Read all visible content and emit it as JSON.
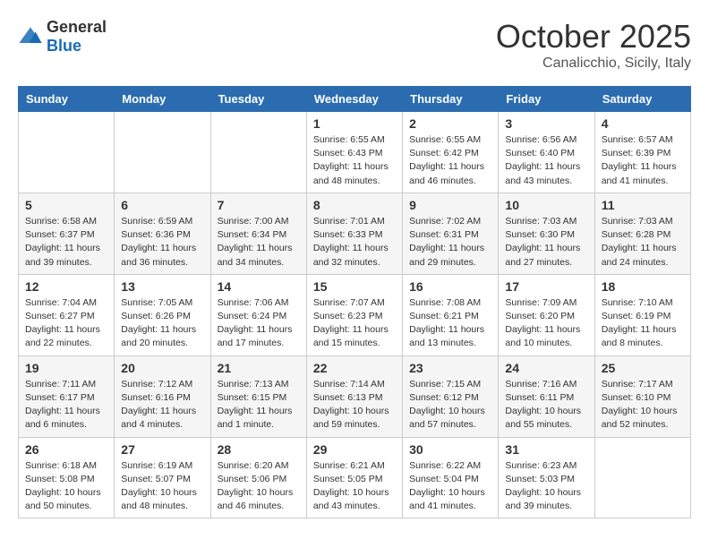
{
  "header": {
    "logo": {
      "general": "General",
      "blue": "Blue"
    },
    "title": "October 2025",
    "location": "Canalicchio, Sicily, Italy"
  },
  "calendar": {
    "weekdays": [
      "Sunday",
      "Monday",
      "Tuesday",
      "Wednesday",
      "Thursday",
      "Friday",
      "Saturday"
    ],
    "weeks": [
      [
        null,
        null,
        null,
        {
          "day": 1,
          "sunrise": "6:55 AM",
          "sunset": "6:43 PM",
          "daylight": "11 hours and 48 minutes."
        },
        {
          "day": 2,
          "sunrise": "6:55 AM",
          "sunset": "6:42 PM",
          "daylight": "11 hours and 46 minutes."
        },
        {
          "day": 3,
          "sunrise": "6:56 AM",
          "sunset": "6:40 PM",
          "daylight": "11 hours and 43 minutes."
        },
        {
          "day": 4,
          "sunrise": "6:57 AM",
          "sunset": "6:39 PM",
          "daylight": "11 hours and 41 minutes."
        }
      ],
      [
        {
          "day": 5,
          "sunrise": "6:58 AM",
          "sunset": "6:37 PM",
          "daylight": "11 hours and 39 minutes."
        },
        {
          "day": 6,
          "sunrise": "6:59 AM",
          "sunset": "6:36 PM",
          "daylight": "11 hours and 36 minutes."
        },
        {
          "day": 7,
          "sunrise": "7:00 AM",
          "sunset": "6:34 PM",
          "daylight": "11 hours and 34 minutes."
        },
        {
          "day": 8,
          "sunrise": "7:01 AM",
          "sunset": "6:33 PM",
          "daylight": "11 hours and 32 minutes."
        },
        {
          "day": 9,
          "sunrise": "7:02 AM",
          "sunset": "6:31 PM",
          "daylight": "11 hours and 29 minutes."
        },
        {
          "day": 10,
          "sunrise": "7:03 AM",
          "sunset": "6:30 PM",
          "daylight": "11 hours and 27 minutes."
        },
        {
          "day": 11,
          "sunrise": "7:03 AM",
          "sunset": "6:28 PM",
          "daylight": "11 hours and 24 minutes."
        }
      ],
      [
        {
          "day": 12,
          "sunrise": "7:04 AM",
          "sunset": "6:27 PM",
          "daylight": "11 hours and 22 minutes."
        },
        {
          "day": 13,
          "sunrise": "7:05 AM",
          "sunset": "6:26 PM",
          "daylight": "11 hours and 20 minutes."
        },
        {
          "day": 14,
          "sunrise": "7:06 AM",
          "sunset": "6:24 PM",
          "daylight": "11 hours and 17 minutes."
        },
        {
          "day": 15,
          "sunrise": "7:07 AM",
          "sunset": "6:23 PM",
          "daylight": "11 hours and 15 minutes."
        },
        {
          "day": 16,
          "sunrise": "7:08 AM",
          "sunset": "6:21 PM",
          "daylight": "11 hours and 13 minutes."
        },
        {
          "day": 17,
          "sunrise": "7:09 AM",
          "sunset": "6:20 PM",
          "daylight": "11 hours and 10 minutes."
        },
        {
          "day": 18,
          "sunrise": "7:10 AM",
          "sunset": "6:19 PM",
          "daylight": "11 hours and 8 minutes."
        }
      ],
      [
        {
          "day": 19,
          "sunrise": "7:11 AM",
          "sunset": "6:17 PM",
          "daylight": "11 hours and 6 minutes."
        },
        {
          "day": 20,
          "sunrise": "7:12 AM",
          "sunset": "6:16 PM",
          "daylight": "11 hours and 4 minutes."
        },
        {
          "day": 21,
          "sunrise": "7:13 AM",
          "sunset": "6:15 PM",
          "daylight": "11 hours and 1 minute."
        },
        {
          "day": 22,
          "sunrise": "7:14 AM",
          "sunset": "6:13 PM",
          "daylight": "10 hours and 59 minutes."
        },
        {
          "day": 23,
          "sunrise": "7:15 AM",
          "sunset": "6:12 PM",
          "daylight": "10 hours and 57 minutes."
        },
        {
          "day": 24,
          "sunrise": "7:16 AM",
          "sunset": "6:11 PM",
          "daylight": "10 hours and 55 minutes."
        },
        {
          "day": 25,
          "sunrise": "7:17 AM",
          "sunset": "6:10 PM",
          "daylight": "10 hours and 52 minutes."
        }
      ],
      [
        {
          "day": 26,
          "sunrise": "6:18 AM",
          "sunset": "5:08 PM",
          "daylight": "10 hours and 50 minutes."
        },
        {
          "day": 27,
          "sunrise": "6:19 AM",
          "sunset": "5:07 PM",
          "daylight": "10 hours and 48 minutes."
        },
        {
          "day": 28,
          "sunrise": "6:20 AM",
          "sunset": "5:06 PM",
          "daylight": "10 hours and 46 minutes."
        },
        {
          "day": 29,
          "sunrise": "6:21 AM",
          "sunset": "5:05 PM",
          "daylight": "10 hours and 43 minutes."
        },
        {
          "day": 30,
          "sunrise": "6:22 AM",
          "sunset": "5:04 PM",
          "daylight": "10 hours and 41 minutes."
        },
        {
          "day": 31,
          "sunrise": "6:23 AM",
          "sunset": "5:03 PM",
          "daylight": "10 hours and 39 minutes."
        },
        null
      ]
    ]
  }
}
